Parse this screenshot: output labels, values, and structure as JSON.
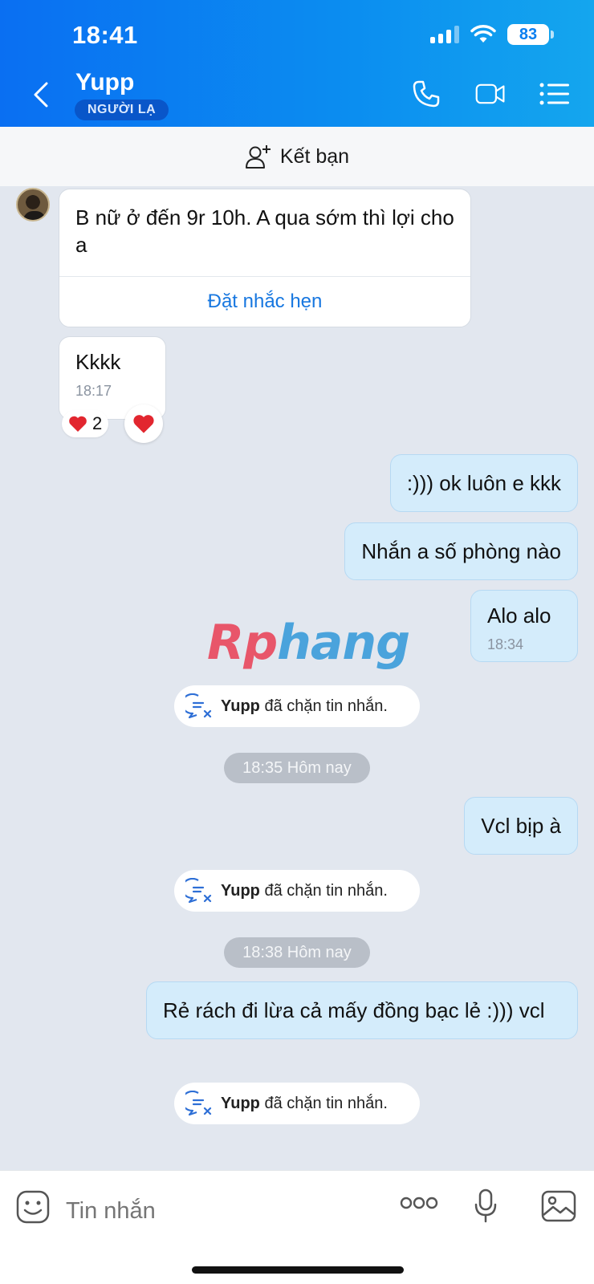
{
  "status_bar": {
    "time": "18:41",
    "battery": "83"
  },
  "header": {
    "name": "Yupp",
    "badge": "NGƯỜI LẠ"
  },
  "friend_bar": {
    "label": "Kết bạn"
  },
  "messages": {
    "m1": {
      "text": "B nữ ở đến 9r 10h. A qua sớm thì lợi cho a",
      "action": "Đặt nhắc hẹn"
    },
    "m2": {
      "text": "Kkkk",
      "time": "18:17",
      "reaction_count": "2"
    },
    "o1": {
      "text": ":))) ok luôn e kkk"
    },
    "o2": {
      "text": "Nhắn a số phòng nào"
    },
    "o3": {
      "text": "Alo alo",
      "time": "18:34"
    },
    "o4": {
      "text": "Vcl bịp à"
    },
    "o5": {
      "text": "Rẻ rách đi lừa cả mấy đồng bạc lẻ :))) vcl"
    }
  },
  "system_notes": {
    "sender": "Yupp",
    "text": "đã chặn tin nhắn."
  },
  "time_separators": [
    "18:35 Hôm nay",
    "18:38 Hôm nay"
  ],
  "watermark": {
    "part1": "Rp",
    "part2": "hang"
  },
  "composer": {
    "placeholder": "Tin nhắn"
  },
  "colors": {
    "header_blue": "#0b8ef0",
    "out_bubble": "#d4ecfb",
    "link": "#1777e0",
    "heart": "#e2262f"
  }
}
